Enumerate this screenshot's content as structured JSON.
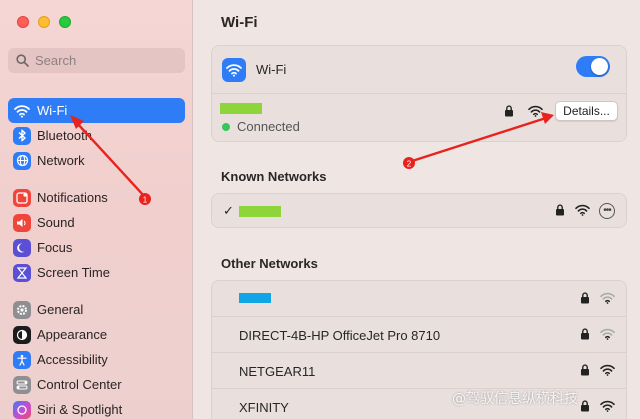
{
  "sidebar": {
    "search_placeholder": "Search",
    "items": [
      {
        "label": "Wi-Fi",
        "icon": "wifi-icon",
        "color": "#2f7df6",
        "active": true
      },
      {
        "label": "Bluetooth",
        "icon": "bluetooth-icon",
        "color": "#2f7df6"
      },
      {
        "label": "Network",
        "icon": "globe-icon",
        "color": "#2f7df6"
      },
      {
        "label": "Notifications",
        "icon": "bell-icon",
        "color": "#f0453a"
      },
      {
        "label": "Sound",
        "icon": "speaker-icon",
        "color": "#f0453a"
      },
      {
        "label": "Focus",
        "icon": "moon-icon",
        "color": "#5b4fd6"
      },
      {
        "label": "Screen Time",
        "icon": "hourglass-icon",
        "color": "#5b4fd6"
      },
      {
        "label": "General",
        "icon": "gear-icon",
        "color": "#8e8e93"
      },
      {
        "label": "Appearance",
        "icon": "appearance-icon",
        "color": "#1c1c1e"
      },
      {
        "label": "Accessibility",
        "icon": "accessibility-icon",
        "color": "#2f7df6"
      },
      {
        "label": "Control Center",
        "icon": "control-center-icon",
        "color": "#8e8e93"
      },
      {
        "label": "Siri & Spotlight",
        "icon": "siri-icon",
        "color": "#b04dd9"
      }
    ]
  },
  "main": {
    "title": "Wi-Fi",
    "wifi_label": "Wi-Fi",
    "wifi_enabled": true,
    "current_network": {
      "status": "Connected",
      "details_label": "Details..."
    },
    "known_networks_heading": "Known Networks",
    "other_networks_heading": "Other Networks",
    "other_networks": [
      {
        "name": ""
      },
      {
        "name": "DIRECT-4B-HP OfficeJet Pro 8710"
      },
      {
        "name": "NETGEAR11"
      },
      {
        "name": "XFINITY"
      }
    ]
  },
  "annotations": {
    "marker_1": "1",
    "marker_2": "2",
    "arrow_color": "#e8221d"
  },
  "watermark": "@驾驭信息纵横科技"
}
